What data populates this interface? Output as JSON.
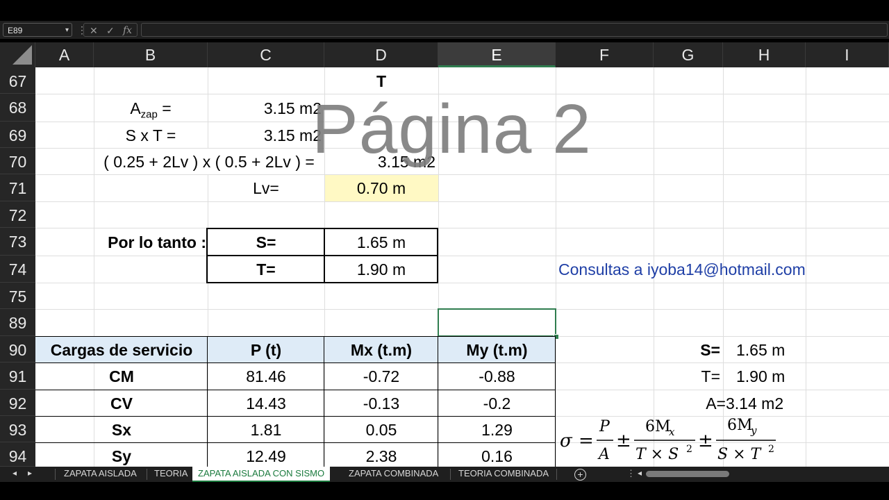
{
  "formula_bar": {
    "name_box": "E89",
    "fx_label": "fx",
    "formula": ""
  },
  "columns": [
    "A",
    "B",
    "C",
    "D",
    "E",
    "F",
    "G",
    "H",
    "I"
  ],
  "selected_column": "E",
  "rows": [
    "67",
    "68",
    "69",
    "70",
    "71",
    "72",
    "73",
    "74",
    "75",
    "89",
    "90",
    "91",
    "92",
    "93",
    "94"
  ],
  "watermark": "Página 2",
  "cells": {
    "d67": "T",
    "azap_a": "A",
    "azap_sub": "zap",
    "azap_eq": " =",
    "c68": "3.15 m2",
    "b69": "S x T =",
    "c69": "3.15 m2",
    "b70": "( 0.25 + 2Lv ) x ( 0.5 + 2Lv ) =",
    "d70": "3.15 m2",
    "c71": "Lv=",
    "d71": "0.70 m",
    "b73": "Por lo tanto :",
    "c73": "S=",
    "d73": "1.65 m",
    "c74": "T=",
    "d74": "1.90 m",
    "contact": "Consultas a iyoba14@hotmail.com"
  },
  "loads_table": {
    "headers": [
      "Cargas de servicio",
      "P (t)",
      "Mx (t.m)",
      "My (t.m)"
    ],
    "rows": [
      [
        "CM",
        "81.46",
        "-0.72",
        "-0.88"
      ],
      [
        "CV",
        "14.43",
        "-0.13",
        "-0.2"
      ],
      [
        "Sx",
        "1.81",
        "0.05",
        "1.29"
      ],
      [
        "Sy",
        "12.49",
        "2.38",
        "0.16"
      ]
    ]
  },
  "summary": {
    "s_label": "S=",
    "s_value": "1.65 m",
    "t_label": "T=",
    "t_value": "1.90 m",
    "a_label": "A=",
    "a_value": "3.14 m2"
  },
  "formula_img": {
    "sigma": "σ",
    "eq": "=",
    "P": "P",
    "A": "A",
    "pm": "±",
    "six_mx": "6M",
    "x": "x",
    "txs": "T × S",
    "two": "2",
    "six_my": "6M",
    "y": "y",
    "sxt": "S × T"
  },
  "sheet_tabs": [
    "ZAPATA AISLADA",
    "TEORIA",
    "ZAPATA AISLADA CON SISMO",
    "ZAPATA COMBINADA",
    "TEORIA COMBINADA"
  ],
  "active_tab": "ZAPATA AISLADA CON SISMO",
  "colors": {
    "selected_header_accent": "#2f7d4f",
    "table_header_fill": "#deebf7",
    "lv_cell_fill": "#fff9c4",
    "contact_text": "#1f3fa6",
    "active_tab_text": "#1a7a3d"
  }
}
